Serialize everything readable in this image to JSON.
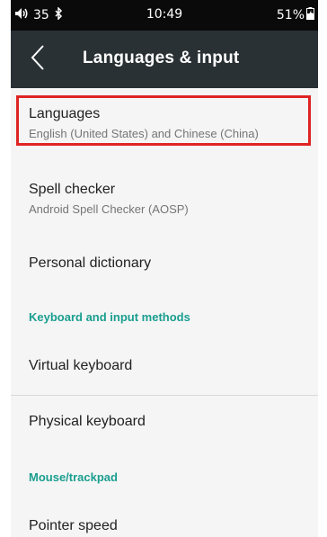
{
  "status_bar": {
    "volume": "35",
    "time": "10:49",
    "battery": "51%"
  },
  "app_bar": {
    "title": "Languages & input"
  },
  "items": [
    {
      "title": "Languages",
      "subtitle": "English (United States) and Chinese (China)"
    },
    {
      "title": "Spell checker",
      "subtitle": "Android Spell Checker (AOSP)"
    },
    {
      "title": "Personal dictionary"
    },
    {
      "title": "Virtual keyboard"
    },
    {
      "title": "Physical keyboard"
    },
    {
      "title": "Pointer speed"
    }
  ],
  "sections": [
    {
      "label": "Keyboard and input methods"
    },
    {
      "label": "Mouse/trackpad"
    }
  ],
  "colors": {
    "accent": "#1a9e8f",
    "highlight": "#e02424",
    "app_bar": "#2a3135"
  },
  "icons": {
    "volume": "volume-icon",
    "bluetooth": "bluetooth-icon",
    "battery": "battery-icon",
    "back": "back-arrow-icon"
  }
}
